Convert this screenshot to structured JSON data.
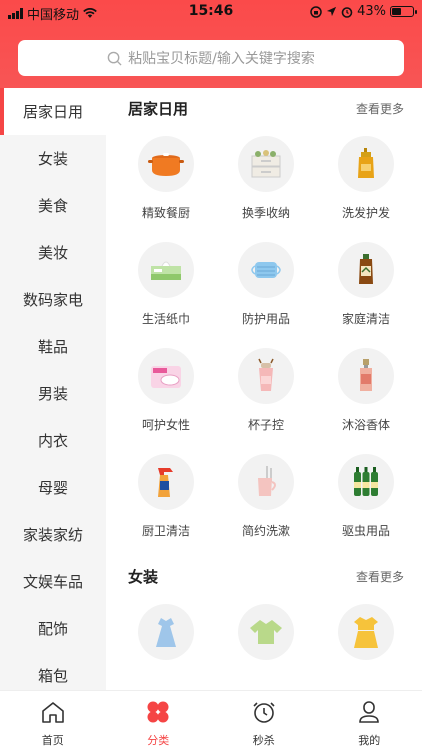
{
  "status_bar": {
    "carrier": "中国移动",
    "time": "15:46",
    "battery": "43%",
    "battery_level": 0.43
  },
  "search": {
    "placeholder": "粘贴宝贝标题/输入关键字搜索"
  },
  "sidebar": {
    "items": [
      {
        "label": "居家日用"
      },
      {
        "label": "女装"
      },
      {
        "label": "美食"
      },
      {
        "label": "美妆"
      },
      {
        "label": "数码家电"
      },
      {
        "label": "鞋品"
      },
      {
        "label": "男装"
      },
      {
        "label": "内衣"
      },
      {
        "label": "母婴"
      },
      {
        "label": "家装家纺"
      },
      {
        "label": "文娱车品"
      },
      {
        "label": "配饰"
      },
      {
        "label": "箱包"
      }
    ],
    "active_index": 0
  },
  "sections": [
    {
      "title": "居家日用",
      "more": "查看更多",
      "items": [
        {
          "label": "精致餐厨",
          "icon": "pot-icon"
        },
        {
          "label": "换季收纳",
          "icon": "storage-box-icon"
        },
        {
          "label": "洗发护发",
          "icon": "shampoo-icon"
        },
        {
          "label": "生活纸巾",
          "icon": "tissue-icon"
        },
        {
          "label": "防护用品",
          "icon": "mask-icon"
        },
        {
          "label": "家庭清洁",
          "icon": "disinfectant-icon"
        },
        {
          "label": "呵护女性",
          "icon": "sanitary-pad-icon"
        },
        {
          "label": "杯子控",
          "icon": "cup-icon"
        },
        {
          "label": "沐浴香体",
          "icon": "body-mist-icon"
        },
        {
          "label": "厨卫清洁",
          "icon": "spray-cleaner-icon"
        },
        {
          "label": "简约洗漱",
          "icon": "toothbrush-cup-icon"
        },
        {
          "label": "驱虫用品",
          "icon": "repellent-bottles-icon"
        }
      ]
    },
    {
      "title": "女装",
      "more": "查看更多",
      "items": [
        {
          "label": "",
          "icon": "dress-icon"
        },
        {
          "label": "",
          "icon": "blouse-icon"
        },
        {
          "label": "",
          "icon": "skirt-set-icon"
        }
      ]
    }
  ],
  "tabbar": {
    "items": [
      {
        "label": "首页",
        "icon": "home-icon"
      },
      {
        "label": "分类",
        "icon": "category-icon"
      },
      {
        "label": "秒杀",
        "icon": "clock-icon"
      },
      {
        "label": "我的",
        "icon": "user-icon"
      }
    ],
    "active_index": 1
  },
  "colors": {
    "accent": "#f54545",
    "header": "#fb4a4a"
  }
}
